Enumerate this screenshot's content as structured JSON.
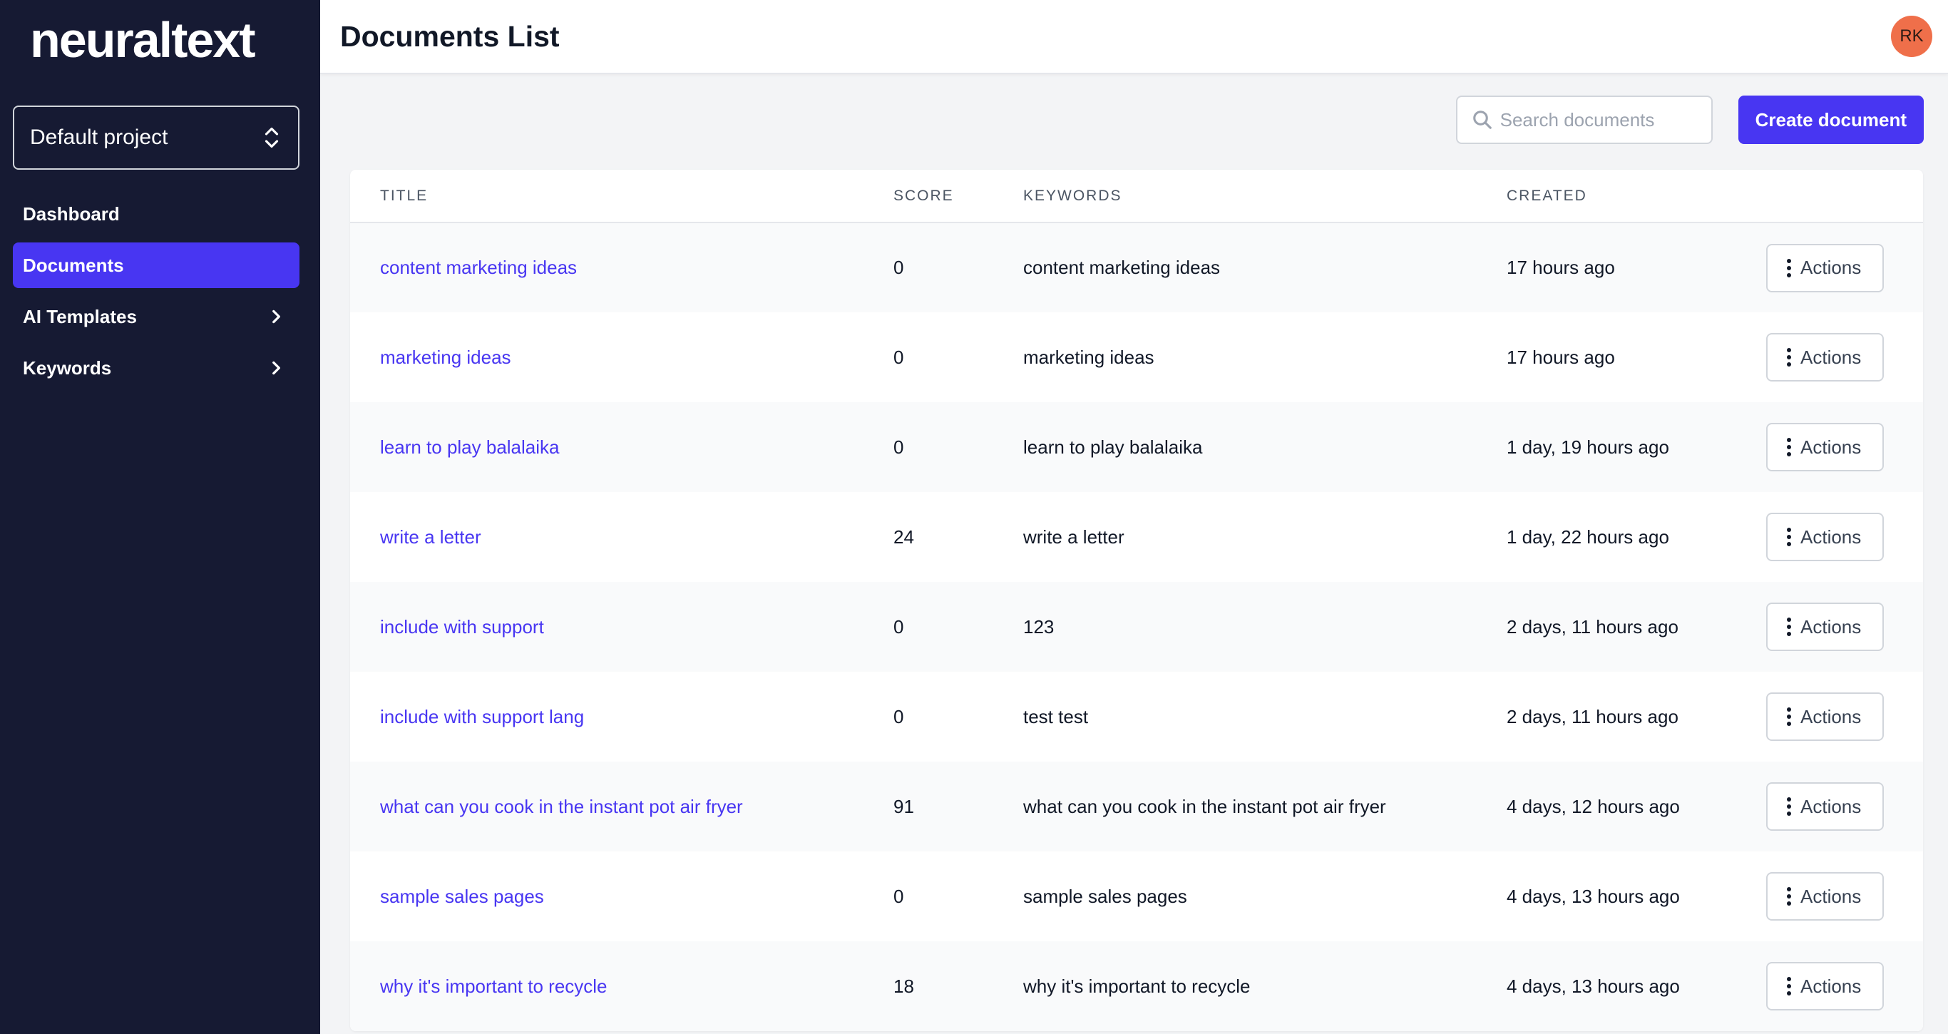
{
  "sidebar": {
    "logo": "neuraltext",
    "project": "Default project",
    "nav": [
      {
        "label": "Dashboard",
        "active": false,
        "chevron": false
      },
      {
        "label": "Documents",
        "active": true,
        "chevron": false
      },
      {
        "label": "AI Templates",
        "active": false,
        "chevron": true
      },
      {
        "label": "Keywords",
        "active": false,
        "chevron": true
      }
    ]
  },
  "header": {
    "title": "Documents List",
    "avatar_initials": "RK"
  },
  "toolbar": {
    "search_placeholder": "Search documents",
    "create_label": "Create document"
  },
  "table": {
    "columns": [
      "TITLE",
      "SCORE",
      "KEYWORDS",
      "CREATED"
    ],
    "action_label": "Actions",
    "rows": [
      {
        "title": "content marketing ideas",
        "score": "0",
        "keywords": "content marketing ideas",
        "created": "17 hours ago"
      },
      {
        "title": "marketing ideas",
        "score": "0",
        "keywords": "marketing ideas",
        "created": "17 hours ago"
      },
      {
        "title": "learn to play balalaika",
        "score": "0",
        "keywords": "learn to play balalaika",
        "created": "1 day, 19 hours ago"
      },
      {
        "title": "write a letter",
        "score": "24",
        "keywords": "write a letter",
        "created": "1 day, 22 hours ago"
      },
      {
        "title": "include with support",
        "score": "0",
        "keywords": "123",
        "created": "2 days, 11 hours ago"
      },
      {
        "title": "include with support lang",
        "score": "0",
        "keywords": "test test",
        "created": "2 days, 11 hours ago"
      },
      {
        "title": "what can you cook in the instant pot air fryer",
        "score": "91",
        "keywords": "what can you cook in the instant pot air fryer",
        "created": "4 days, 12 hours ago"
      },
      {
        "title": "sample sales pages",
        "score": "0",
        "keywords": "sample sales pages",
        "created": "4 days, 13 hours ago"
      },
      {
        "title": "why it's important to recycle",
        "score": "18",
        "keywords": "why it's important to recycle",
        "created": "4 days, 13 hours ago"
      }
    ]
  },
  "colors": {
    "accent": "#4836f2",
    "sidebar_bg": "#161a33",
    "avatar_bg": "#ef6f4a"
  }
}
